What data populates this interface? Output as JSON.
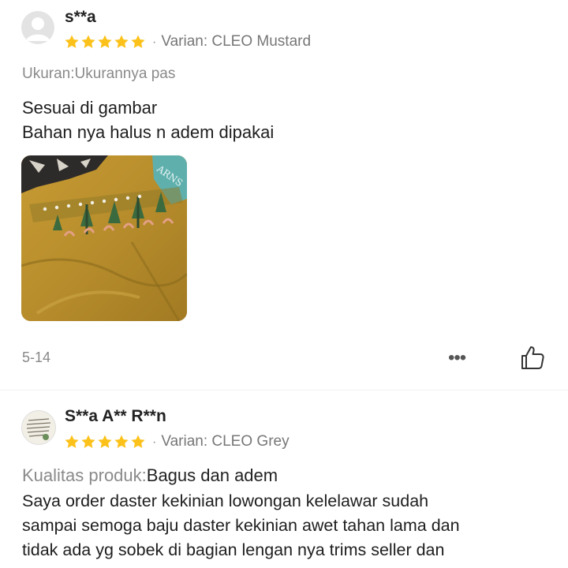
{
  "reviews": [
    {
      "username": "s**a",
      "rating": 5,
      "variant": "Varian: CLEO Mustard",
      "attribute_label": "Ukuran:",
      "attribute_value": "Ukurannya pas",
      "text": "Sesuai di gambar\nBahan nya halus n adem dipakai",
      "date": "5-14",
      "more_label": "•••"
    },
    {
      "username": "S**a A** R**n",
      "rating": 5,
      "variant": "Varian: CLEO Grey",
      "attribute_label": "Kualitas produk:",
      "attribute_value": "Bagus dan adem",
      "text": "Saya order daster kekinian lowongan kelelawar sudah\nsampai semoga baju daster kekinian awet tahan lama dan\ntidak ada yg sobek di bagian lengan nya trims seller dan"
    }
  ],
  "colors": {
    "star": "#fcc21b",
    "brand_mustard": "#b8902f"
  },
  "icons": {
    "star": "star-icon",
    "like": "thumbs-up-icon",
    "more": "more-dots-icon",
    "avatar": "default-avatar-icon"
  }
}
